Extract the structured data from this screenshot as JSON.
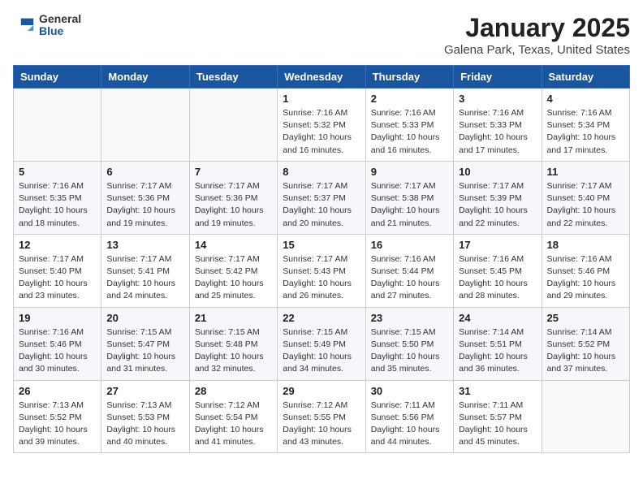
{
  "logo": {
    "general": "General",
    "blue": "Blue"
  },
  "title": "January 2025",
  "subtitle": "Galena Park, Texas, United States",
  "days_of_week": [
    "Sunday",
    "Monday",
    "Tuesday",
    "Wednesday",
    "Thursday",
    "Friday",
    "Saturday"
  ],
  "weeks": [
    [
      {
        "day": "",
        "info": ""
      },
      {
        "day": "",
        "info": ""
      },
      {
        "day": "",
        "info": ""
      },
      {
        "day": "1",
        "info": "Sunrise: 7:16 AM\nSunset: 5:32 PM\nDaylight: 10 hours\nand 16 minutes."
      },
      {
        "day": "2",
        "info": "Sunrise: 7:16 AM\nSunset: 5:33 PM\nDaylight: 10 hours\nand 16 minutes."
      },
      {
        "day": "3",
        "info": "Sunrise: 7:16 AM\nSunset: 5:33 PM\nDaylight: 10 hours\nand 17 minutes."
      },
      {
        "day": "4",
        "info": "Sunrise: 7:16 AM\nSunset: 5:34 PM\nDaylight: 10 hours\nand 17 minutes."
      }
    ],
    [
      {
        "day": "5",
        "info": "Sunrise: 7:16 AM\nSunset: 5:35 PM\nDaylight: 10 hours\nand 18 minutes."
      },
      {
        "day": "6",
        "info": "Sunrise: 7:17 AM\nSunset: 5:36 PM\nDaylight: 10 hours\nand 19 minutes."
      },
      {
        "day": "7",
        "info": "Sunrise: 7:17 AM\nSunset: 5:36 PM\nDaylight: 10 hours\nand 19 minutes."
      },
      {
        "day": "8",
        "info": "Sunrise: 7:17 AM\nSunset: 5:37 PM\nDaylight: 10 hours\nand 20 minutes."
      },
      {
        "day": "9",
        "info": "Sunrise: 7:17 AM\nSunset: 5:38 PM\nDaylight: 10 hours\nand 21 minutes."
      },
      {
        "day": "10",
        "info": "Sunrise: 7:17 AM\nSunset: 5:39 PM\nDaylight: 10 hours\nand 22 minutes."
      },
      {
        "day": "11",
        "info": "Sunrise: 7:17 AM\nSunset: 5:40 PM\nDaylight: 10 hours\nand 22 minutes."
      }
    ],
    [
      {
        "day": "12",
        "info": "Sunrise: 7:17 AM\nSunset: 5:40 PM\nDaylight: 10 hours\nand 23 minutes."
      },
      {
        "day": "13",
        "info": "Sunrise: 7:17 AM\nSunset: 5:41 PM\nDaylight: 10 hours\nand 24 minutes."
      },
      {
        "day": "14",
        "info": "Sunrise: 7:17 AM\nSunset: 5:42 PM\nDaylight: 10 hours\nand 25 minutes."
      },
      {
        "day": "15",
        "info": "Sunrise: 7:17 AM\nSunset: 5:43 PM\nDaylight: 10 hours\nand 26 minutes."
      },
      {
        "day": "16",
        "info": "Sunrise: 7:16 AM\nSunset: 5:44 PM\nDaylight: 10 hours\nand 27 minutes."
      },
      {
        "day": "17",
        "info": "Sunrise: 7:16 AM\nSunset: 5:45 PM\nDaylight: 10 hours\nand 28 minutes."
      },
      {
        "day": "18",
        "info": "Sunrise: 7:16 AM\nSunset: 5:46 PM\nDaylight: 10 hours\nand 29 minutes."
      }
    ],
    [
      {
        "day": "19",
        "info": "Sunrise: 7:16 AM\nSunset: 5:46 PM\nDaylight: 10 hours\nand 30 minutes."
      },
      {
        "day": "20",
        "info": "Sunrise: 7:15 AM\nSunset: 5:47 PM\nDaylight: 10 hours\nand 31 minutes."
      },
      {
        "day": "21",
        "info": "Sunrise: 7:15 AM\nSunset: 5:48 PM\nDaylight: 10 hours\nand 32 minutes."
      },
      {
        "day": "22",
        "info": "Sunrise: 7:15 AM\nSunset: 5:49 PM\nDaylight: 10 hours\nand 34 minutes."
      },
      {
        "day": "23",
        "info": "Sunrise: 7:15 AM\nSunset: 5:50 PM\nDaylight: 10 hours\nand 35 minutes."
      },
      {
        "day": "24",
        "info": "Sunrise: 7:14 AM\nSunset: 5:51 PM\nDaylight: 10 hours\nand 36 minutes."
      },
      {
        "day": "25",
        "info": "Sunrise: 7:14 AM\nSunset: 5:52 PM\nDaylight: 10 hours\nand 37 minutes."
      }
    ],
    [
      {
        "day": "26",
        "info": "Sunrise: 7:13 AM\nSunset: 5:52 PM\nDaylight: 10 hours\nand 39 minutes."
      },
      {
        "day": "27",
        "info": "Sunrise: 7:13 AM\nSunset: 5:53 PM\nDaylight: 10 hours\nand 40 minutes."
      },
      {
        "day": "28",
        "info": "Sunrise: 7:12 AM\nSunset: 5:54 PM\nDaylight: 10 hours\nand 41 minutes."
      },
      {
        "day": "29",
        "info": "Sunrise: 7:12 AM\nSunset: 5:55 PM\nDaylight: 10 hours\nand 43 minutes."
      },
      {
        "day": "30",
        "info": "Sunrise: 7:11 AM\nSunset: 5:56 PM\nDaylight: 10 hours\nand 44 minutes."
      },
      {
        "day": "31",
        "info": "Sunrise: 7:11 AM\nSunset: 5:57 PM\nDaylight: 10 hours\nand 45 minutes."
      },
      {
        "day": "",
        "info": ""
      }
    ]
  ]
}
